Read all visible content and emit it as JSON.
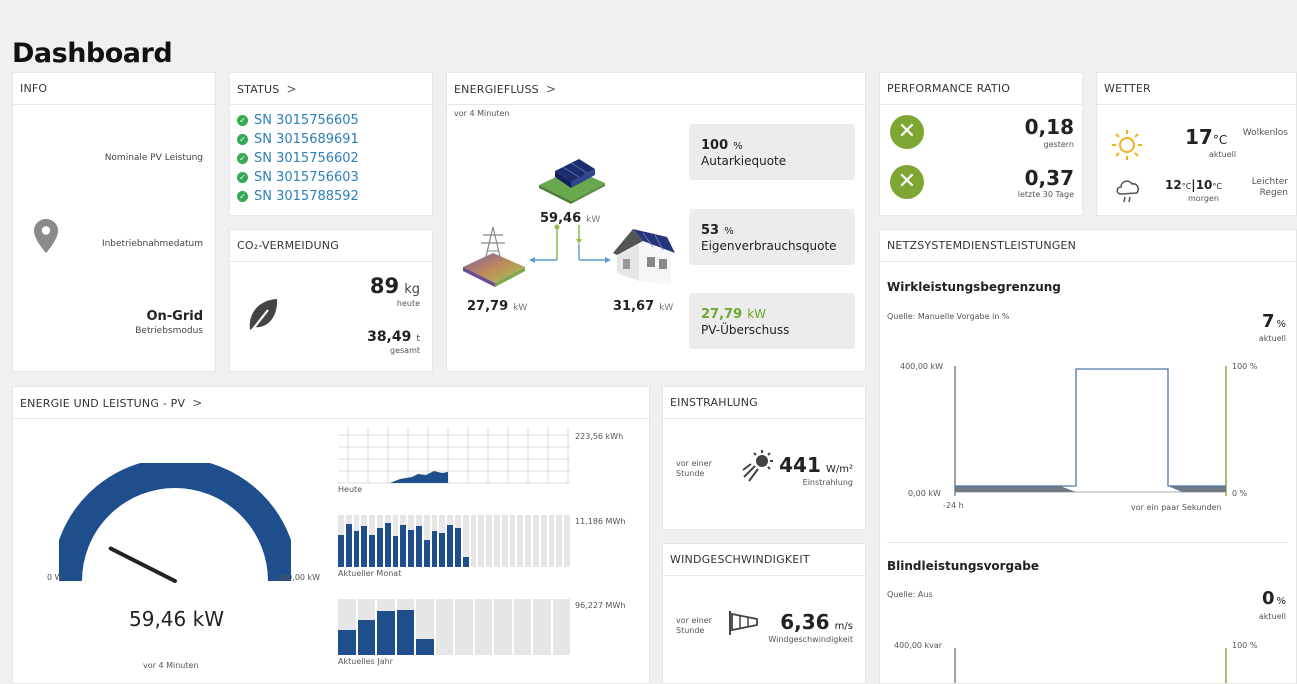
{
  "page": {
    "title": "Dashboard"
  },
  "info": {
    "title": "INFO",
    "nominal_label": "Nominale PV Leistung",
    "commissioning_label": "Inbetriebnahmedatum",
    "mode_value": "On-Grid",
    "mode_label": "Betriebsmodus"
  },
  "status": {
    "title": "STATUS",
    "chevron": ">",
    "items": [
      "SN 3015756605",
      "SN 3015689691",
      "SN 3015756602",
      "SN 3015756603",
      "SN 3015788592"
    ]
  },
  "co2": {
    "title": "CO₂-VERMEIDUNG",
    "today_value": "89",
    "today_unit": "kg",
    "today_label": "heute",
    "total_value": "38,49",
    "total_unit": "t",
    "total_label": "gesamt"
  },
  "energy_flow": {
    "title": "ENERGIEFLUSS",
    "chevron": ">",
    "time": "vor 4 Minuten",
    "pv_value": "59,46",
    "pv_unit": "kW",
    "grid_value": "27,79",
    "grid_unit": "kW",
    "house_value": "31,67",
    "house_unit": "kW",
    "autarky_value": "100",
    "autarky_unit": "%",
    "autarky_label": "Autarkiequote",
    "selfuse_value": "53",
    "selfuse_unit": "%",
    "selfuse_label": "Eigenverbrauchsquote",
    "surplus_value": "27,79",
    "surplus_unit": "kW",
    "surplus_label": "PV-Überschuss"
  },
  "performance": {
    "title": "PERFORMANCE RATIO",
    "yesterday_value": "0,18",
    "yesterday_label": "gestern",
    "month_value": "0,37",
    "month_label": "letzte 30 Tage"
  },
  "weather": {
    "title": "WETTER",
    "now_temp": "17",
    "now_unit": "°C",
    "now_label": "aktuell",
    "now_desc": "Wolkenlos",
    "tomorrow_max": "12",
    "tomorrow_min": "10",
    "tomorrow_unit": "°C",
    "tomorrow_label": "morgen",
    "tomorrow_desc": "Leichter Regen"
  },
  "pv": {
    "title": "ENERGIE UND LEISTUNG - PV",
    "chevron": ">",
    "gauge_min": "0 W",
    "gauge_max": "400,00 kW",
    "gauge_value": "59,46 kW",
    "gauge_fraction": 0.149,
    "time": "vor 4 Minuten",
    "today_total": "223,56 kWh",
    "today_label": "Heute",
    "month_total": "11,186 MWh",
    "month_label": "Aktueller Monat",
    "year_total": "96,227 MWh",
    "year_label": "Aktuelles Jahr"
  },
  "irradiance": {
    "title": "EINSTRAHLUNG",
    "time": "vor einer Stunde",
    "value": "441",
    "unit": "W/m²",
    "label": "Einstrahlung"
  },
  "wind": {
    "title": "WINDGESCHWINDIGKEIT",
    "time": "vor einer Stunde",
    "value": "6,36",
    "unit": "m/s",
    "label": "Windgeschwindigkeit"
  },
  "grid_services": {
    "title": "NETZSYSTEMDIENSTLEISTUNGEN",
    "active": {
      "title": "Wirkleistungsbegrenzung",
      "source": "Quelle: Manuelle Vorgabe in %",
      "value": "7",
      "unit": "%",
      "label": "aktuell",
      "y_top": "400,00 kW",
      "y_bottom": "0,00 kW",
      "r_top": "100 %",
      "r_bottom": "0 %",
      "x_left": "-24 h",
      "x_right": "vor ein paar Sekunden"
    },
    "reactive": {
      "title": "Blindleistungsvorgabe",
      "source": "Quelle: Aus",
      "value": "0",
      "unit": "%",
      "label": "aktuell",
      "y_top": "400,00 kvar",
      "r_top": "100 %"
    }
  }
}
